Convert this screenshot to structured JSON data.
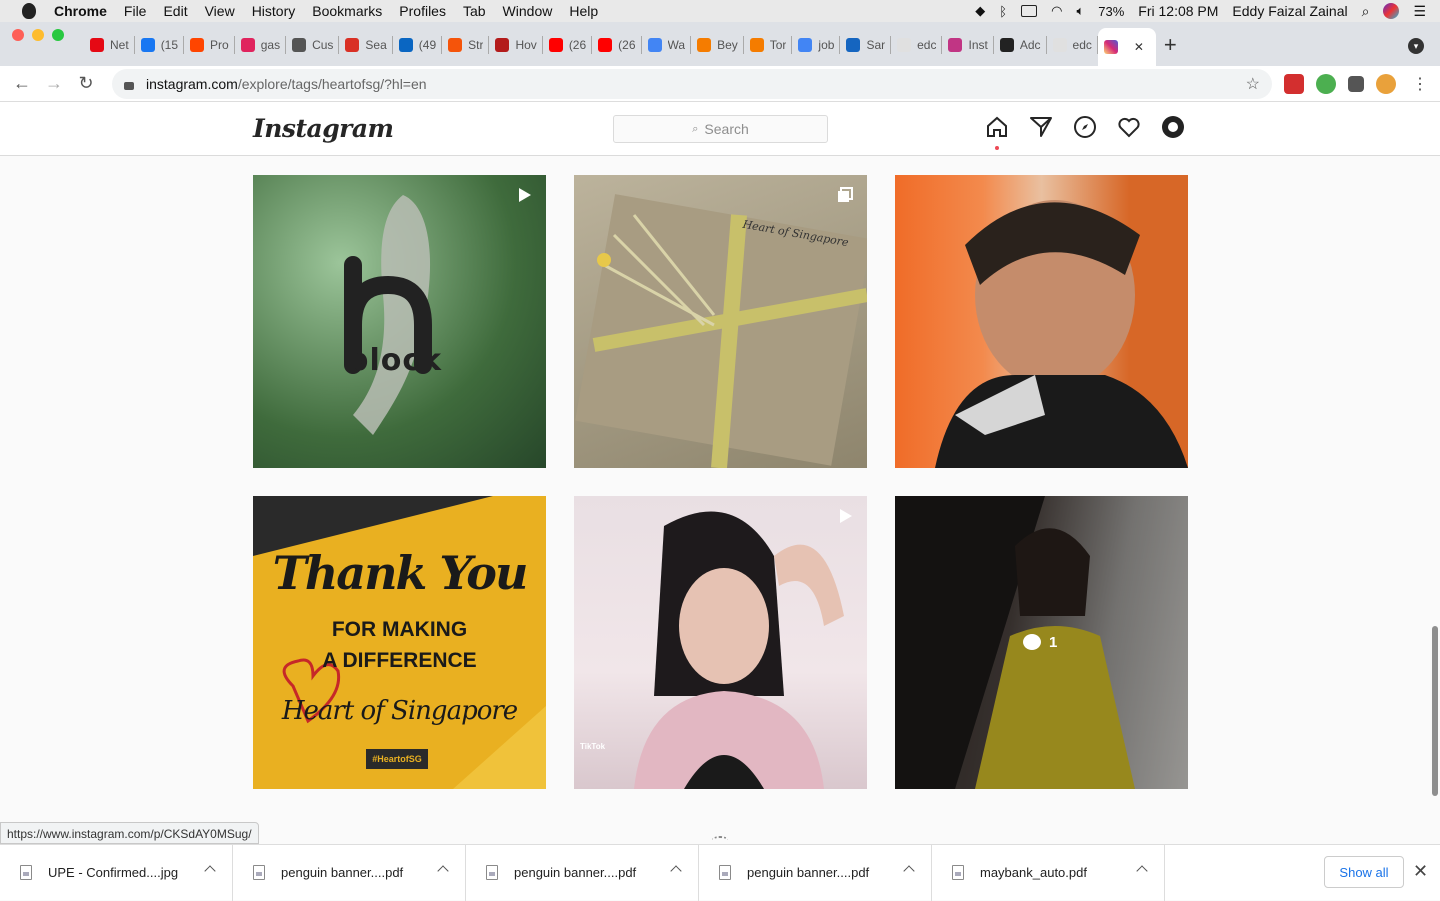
{
  "menubar": {
    "app": "Chrome",
    "items": [
      "File",
      "Edit",
      "View",
      "History",
      "Bookmarks",
      "Profiles",
      "Tab",
      "Window",
      "Help"
    ],
    "battery": "73%",
    "clock": "Fri 12:08 PM",
    "user": "Eddy Faizal Zainal"
  },
  "tabs": [
    {
      "label": "Net",
      "color": "#e50914"
    },
    {
      "label": "(15",
      "color": "#1877f2"
    },
    {
      "label": "Pro",
      "color": "#ff4500"
    },
    {
      "label": "gas",
      "color": "#e0245e"
    },
    {
      "label": "Cus",
      "color": "#555555"
    },
    {
      "label": "Sea",
      "color": "#d93025"
    },
    {
      "label": "(49",
      "color": "#0a66c2"
    },
    {
      "label": "Str",
      "color": "#f5540a"
    },
    {
      "label": "Hov",
      "color": "#b31b1b"
    },
    {
      "label": "(26",
      "color": "#ff0000"
    },
    {
      "label": "(26",
      "color": "#ff0000"
    },
    {
      "label": "Wa",
      "color": "#4285f4"
    },
    {
      "label": "Bey",
      "color": "#f57c00"
    },
    {
      "label": "Tor",
      "color": "#f57c00"
    },
    {
      "label": "job",
      "color": "#4285f4"
    },
    {
      "label": "Sar",
      "color": "#1565c0"
    },
    {
      "label": "edc",
      "color": "#e0e0e0"
    },
    {
      "label": "Inst",
      "color": "#c13584"
    },
    {
      "label": "Adc",
      "color": "#222222"
    },
    {
      "label": "edc",
      "color": "#e0e0e0"
    }
  ],
  "active_tab": {
    "close": "✕"
  },
  "toolbar": {
    "url_host": "instagram.com",
    "url_path": "/explore/tags/heartofsg/?hl=en"
  },
  "instagram": {
    "logo": "Instagram",
    "search_placeholder": "Search"
  },
  "posts": [
    {
      "type": "video",
      "caption": "block"
    },
    {
      "type": "carousel",
      "caption": "Heart of Singapore"
    },
    {
      "type": "image",
      "caption": ""
    },
    {
      "type": "image",
      "line1": "Thank You",
      "line2": "FOR MAKING",
      "line3": "A DIFFERENCE",
      "line4": "Heart of Singapore",
      "tag": "#HeartofSG"
    },
    {
      "type": "video",
      "caption": "TikTok"
    },
    {
      "type": "image",
      "comments": "1"
    }
  ],
  "status_url": "https://www.instagram.com/p/CKSdAY0MSug/",
  "downloads": [
    {
      "name": "UPE - Confirmed....jpg"
    },
    {
      "name": "penguin banner....pdf"
    },
    {
      "name": "penguin banner....pdf"
    },
    {
      "name": "penguin banner....pdf"
    },
    {
      "name": "maybank_auto.pdf"
    }
  ],
  "downloads_show_all": "Show all",
  "colors": {
    "accent": "#1a73e8",
    "notification": "#ed4956",
    "yellow": "#e9b021"
  }
}
